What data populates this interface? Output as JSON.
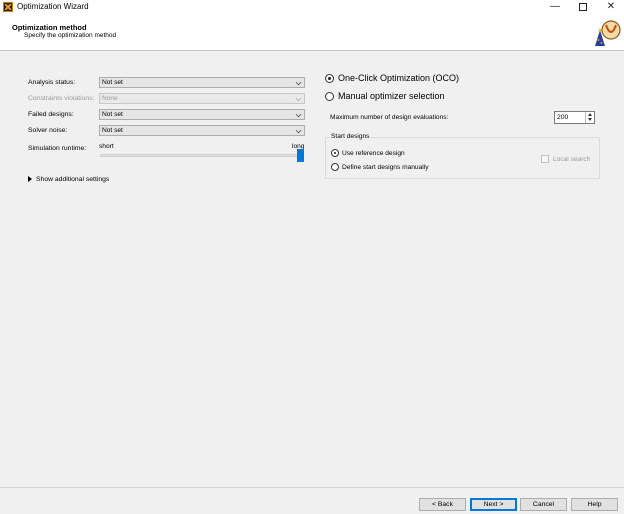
{
  "window": {
    "title": "Optimization Wizard",
    "minimize": "—",
    "close": "✕"
  },
  "header": {
    "title": "Optimization method",
    "subtitle": "Specify the optimization method"
  },
  "left": {
    "analysis_status": {
      "label": "Analysis status:",
      "value": "Not set"
    },
    "constraints_violations": {
      "label": "Constraints violations:",
      "value": "None"
    },
    "failed_designs": {
      "label": "Failed designs:",
      "value": "Not set"
    },
    "solver_noise": {
      "label": "Solver noise:",
      "value": "Not set"
    },
    "simulation_runtime": {
      "label": "Simulation runtime:",
      "min_label": "short",
      "max_label": "long",
      "value_fraction": 1.0
    },
    "show_additional": "Show additional settings"
  },
  "right": {
    "oco_label": "One-Click Optimization (OCO)",
    "manual_label": "Manual optimizer selection",
    "selected_method": "oco",
    "max_evals_label": "Maximum number of design evaluations:",
    "max_evals_value": "200",
    "start_designs": {
      "title": "Start designs",
      "use_reference": "Use reference design",
      "define_manually": "Define start designs manually",
      "local_search": "Local search"
    }
  },
  "footer": {
    "back": "< Back",
    "next": "Next >",
    "cancel": "Cancel",
    "help": "Help"
  },
  "colors": {
    "accent": "#0078d7",
    "background": "#f0f0f0"
  }
}
